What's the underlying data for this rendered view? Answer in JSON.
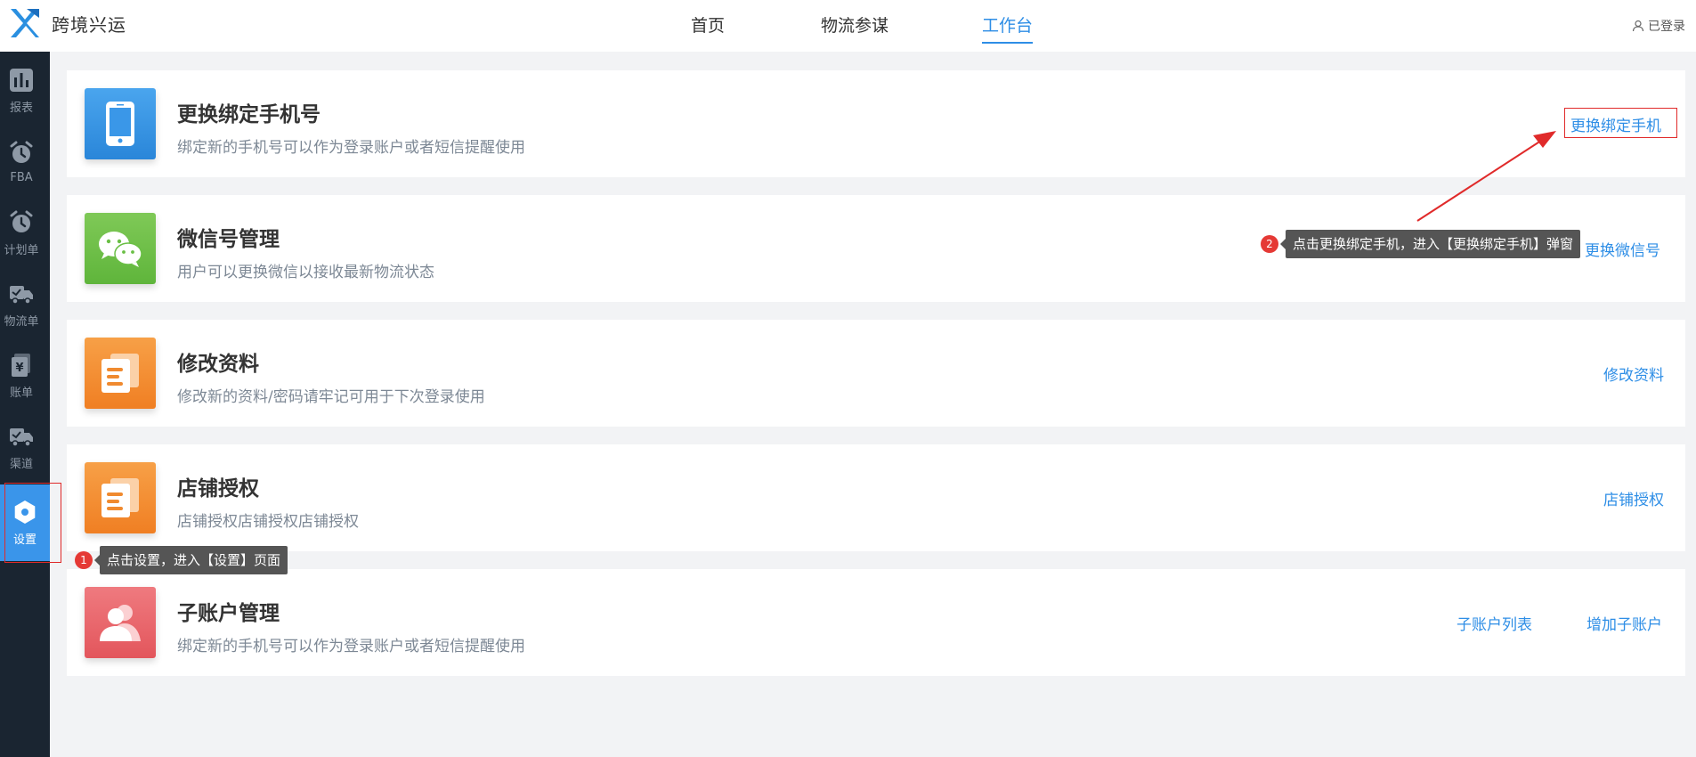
{
  "header": {
    "brand": "跨境兴运",
    "nav": [
      {
        "label": "首页",
        "active": false
      },
      {
        "label": "物流参谋",
        "active": false
      },
      {
        "label": "工作台",
        "active": true
      }
    ],
    "user_label": "已登录",
    "accent_color": "#2e8ee6"
  },
  "sidebar": {
    "items": [
      {
        "label": "报表",
        "icon": "bar-chart-icon"
      },
      {
        "label": "FBA",
        "icon": "alarm-clock-icon"
      },
      {
        "label": "计划单",
        "icon": "alarm-clock-icon"
      },
      {
        "label": "物流单",
        "icon": "truck-icon"
      },
      {
        "label": "账单",
        "icon": "bill-icon"
      },
      {
        "label": "渠道",
        "icon": "truck-icon"
      },
      {
        "label": "设置",
        "icon": "hexagon-settings-icon",
        "active": true
      }
    ]
  },
  "cards": [
    {
      "title": "更换绑定手机号",
      "desc": "绑定新的手机号可以作为登录账户或者短信提醒使用",
      "actions": [
        "更换绑定手机"
      ],
      "icon": "phone-icon",
      "color": "blue"
    },
    {
      "title": "微信号管理",
      "desc": "用户可以更换微信以接收最新物流状态",
      "actions": [
        "更换微信号"
      ],
      "icon": "wechat-icon",
      "color": "green"
    },
    {
      "title": "修改资料",
      "desc": "修改新的资料/密码请牢记可用于下次登录使用",
      "actions": [
        "修改资料"
      ],
      "icon": "documents-icon",
      "color": "orange"
    },
    {
      "title": "店铺授权",
      "desc": "店铺授权店铺授权店铺授权",
      "actions": [
        "店铺授权"
      ],
      "icon": "documents-icon",
      "color": "orange"
    },
    {
      "title": "子账户管理",
      "desc": "绑定新的手机号可以作为登录账户或者短信提醒使用",
      "actions": [
        "子账户列表",
        "增加子账户"
      ],
      "icon": "users-icon",
      "color": "red"
    }
  ],
  "annotations": [
    {
      "num": "1",
      "text": "点击设置，进入【设置】页面"
    },
    {
      "num": "2",
      "text": "点击更换绑定手机，进入【更换绑定手机】弹窗"
    }
  ]
}
